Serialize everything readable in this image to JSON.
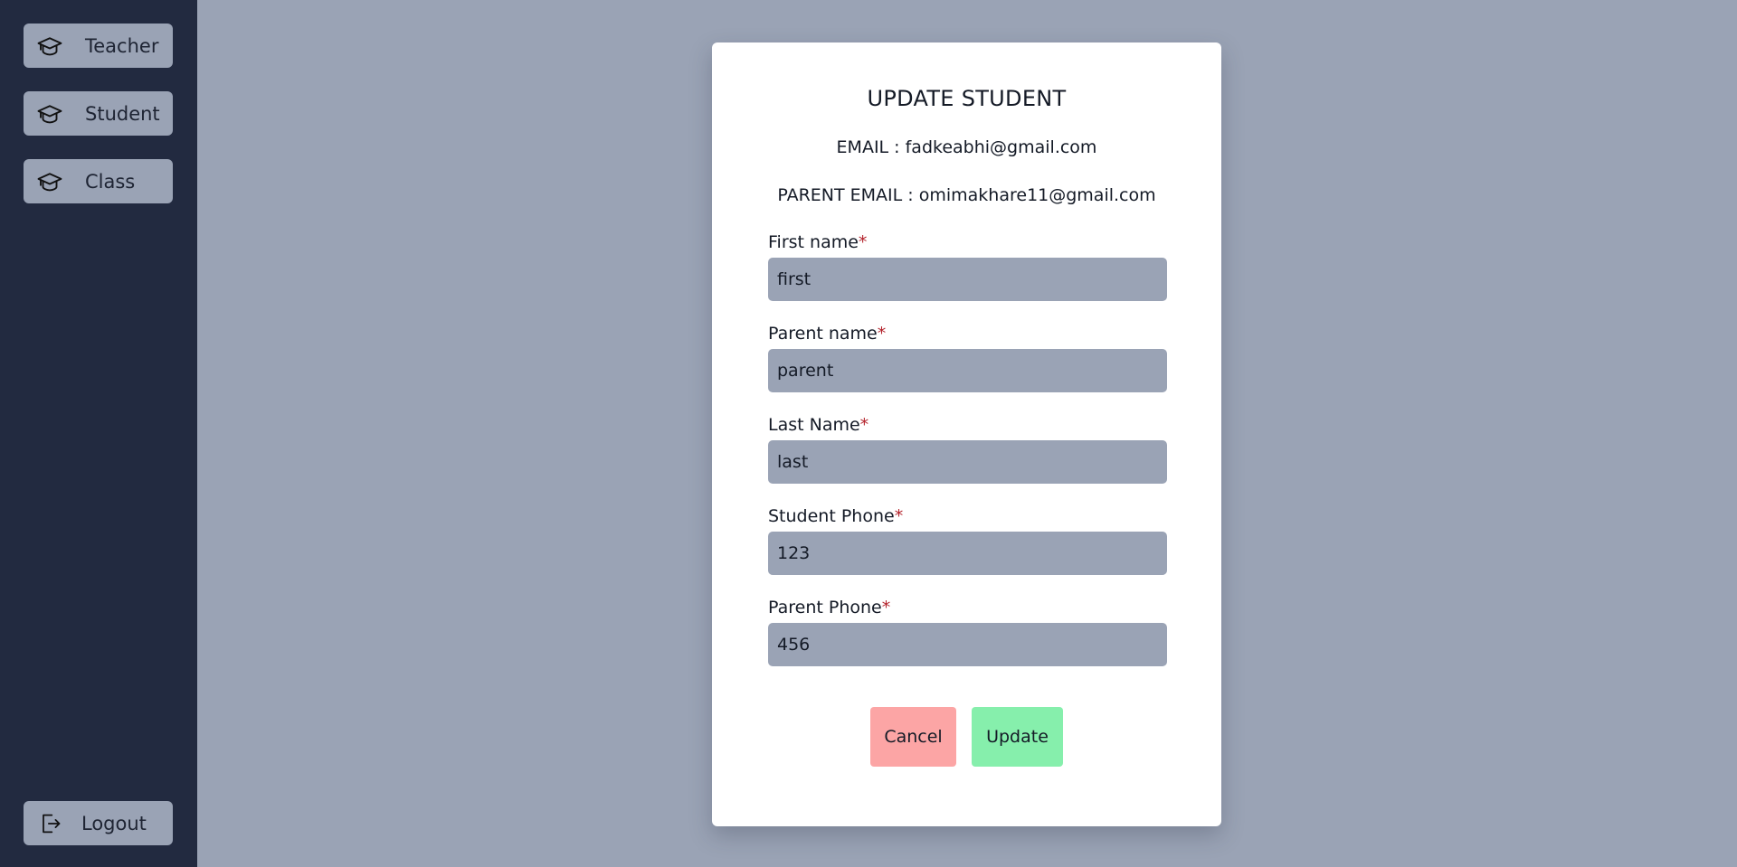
{
  "sidebar": {
    "items": [
      {
        "label": "Teacher",
        "icon": "graduation-cap-icon"
      },
      {
        "label": "Student",
        "icon": "graduation-cap-icon"
      },
      {
        "label": "Class",
        "icon": "graduation-cap-icon"
      }
    ],
    "logout": {
      "label": "Logout",
      "icon": "logout-icon"
    }
  },
  "modal": {
    "title": "UPDATE STUDENT",
    "email_line": "EMAIL : fadkeabhi@gmail.com",
    "parent_email_line": "PARENT EMAIL : omimakhare11@gmail.com",
    "fields": [
      {
        "label": "First name",
        "required_mark": "*",
        "value": "first"
      },
      {
        "label": "Parent name",
        "required_mark": "*",
        "value": "parent"
      },
      {
        "label": "Last Name",
        "required_mark": "*",
        "value": "last"
      },
      {
        "label": "Student Phone",
        "required_mark": "*",
        "value": "123"
      },
      {
        "label": "Parent Phone",
        "required_mark": "*",
        "value": "456"
      }
    ],
    "cancel_label": "Cancel",
    "update_label": "Update"
  },
  "colors": {
    "sidebar_bg": "#222a40",
    "page_bg": "#9aa3b5",
    "cancel_bg": "#fca5a5",
    "update_bg": "#86efac",
    "required": "#b4232c"
  }
}
